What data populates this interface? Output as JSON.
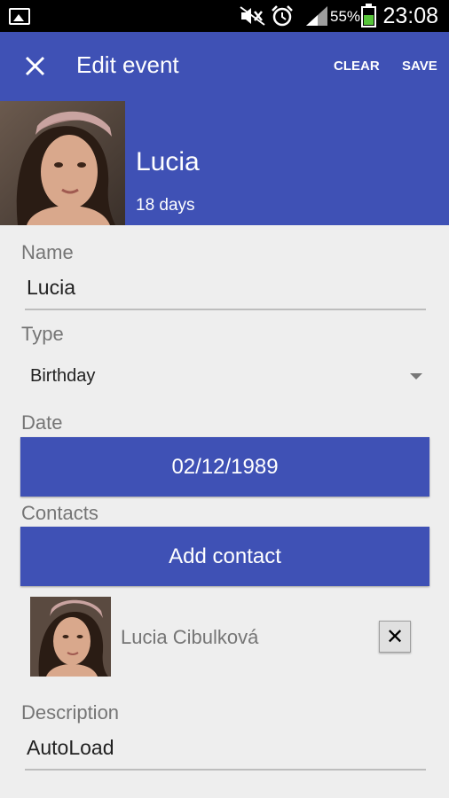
{
  "status_bar": {
    "battery": "55%",
    "time": "23:08",
    "icons": [
      "gallery-icon",
      "mute-icon",
      "alarm-icon",
      "signal-icon",
      "battery-icon"
    ]
  },
  "app_bar": {
    "title": "Edit event",
    "clear_label": "CLEAR",
    "save_label": "SAVE",
    "close_icon": "close-icon"
  },
  "header": {
    "name": "Lucia",
    "countdown": "18 days"
  },
  "form": {
    "name_label": "Name",
    "name_value": "Lucia",
    "type_label": "Type",
    "type_value": "Birthday",
    "date_label": "Date",
    "date_value": "02/12/1989",
    "contacts_label": "Contacts",
    "add_contact_label": "Add contact",
    "contacts": [
      {
        "name": "Lucia Cibulková",
        "remove_icon": "close-icon"
      }
    ],
    "description_label": "Description",
    "description_value": "AutoLoad"
  },
  "colors": {
    "primary": "#3f51b5",
    "background": "#eeeeee",
    "status_bar": "#000000",
    "battery_fill": "#57c43a"
  }
}
